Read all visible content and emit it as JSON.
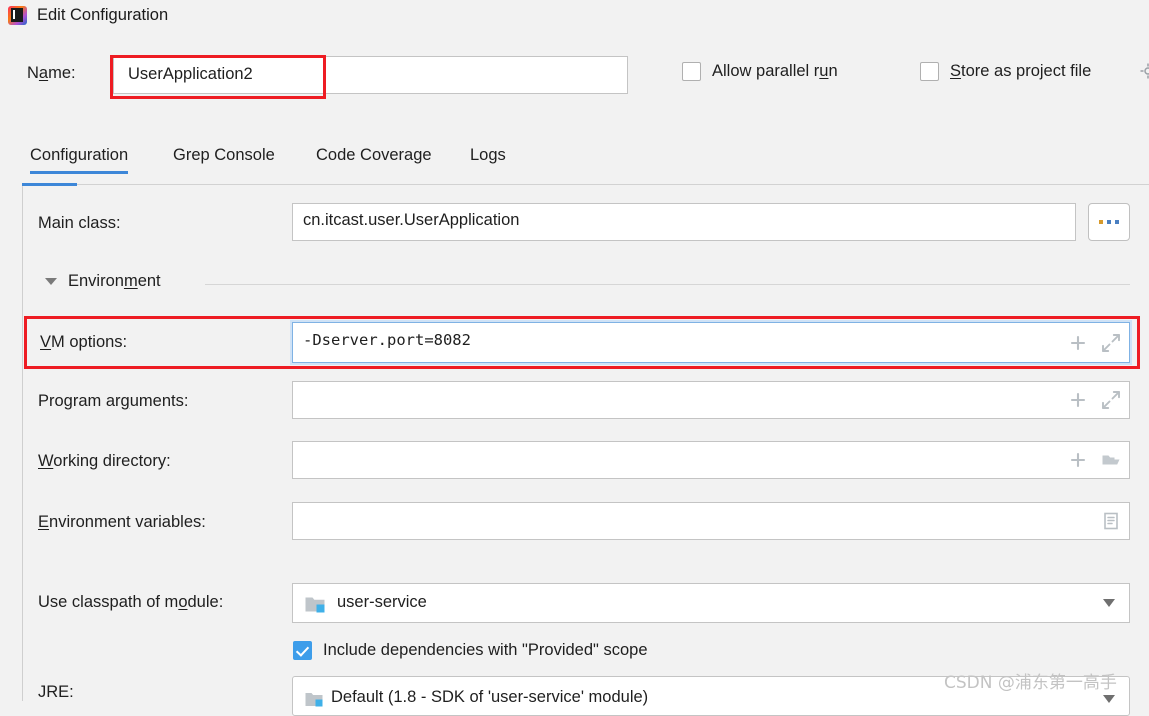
{
  "window": {
    "title": "Edit Configuration",
    "logo_icon": "intellij-idea-logo"
  },
  "name_row": {
    "label_pre": "N",
    "label_mnemonic": "a",
    "label_post": "me:",
    "label_full": "Name:",
    "value": "UserApplication2",
    "highlighted": true,
    "highlight_color": "#ee1c23"
  },
  "checkboxes_top": [
    {
      "name": "allow-parallel-run",
      "label_pre": "Allow parallel r",
      "label_mnemonic": "u",
      "label_post": "n",
      "label_full": "Allow parallel run",
      "checked": false
    },
    {
      "name": "store-as-project-file",
      "label_pre": "",
      "label_mnemonic": "S",
      "label_post": "tore as project file",
      "label_full": "Store as project file",
      "checked": false,
      "trailing_icon": "gear-icon"
    }
  ],
  "tabs": {
    "active_index": 0,
    "accent_color": "#3d87d8",
    "items": [
      {
        "label": "Configuration"
      },
      {
        "label": "Grep Console"
      },
      {
        "label": "Code Coverage"
      },
      {
        "label": "Logs"
      }
    ]
  },
  "form": {
    "main_class": {
      "label": "Main class:",
      "value": "cn.itcast.user.UserApplication",
      "browse_button_label": "...",
      "browse_icon": "ellipsis-icon"
    },
    "environment_section": {
      "label_pre": "Environ",
      "label_mnemonic": "m",
      "label_post": "ent",
      "label_full": "Environment",
      "expanded": true,
      "caret_icon": "chevron-down-icon"
    },
    "vm_options": {
      "label_pre": "",
      "label_mnemonic": "V",
      "label_post": "M options:",
      "label_full": "VM options:",
      "value": "-Dserver.port=8082",
      "focused": true,
      "highlighted": true,
      "highlight_color": "#ee1c23",
      "icons": [
        "plus-icon",
        "expand-icon"
      ]
    },
    "program_arguments": {
      "label_pre": "Program ar",
      "label_mnemonic": "g",
      "label_post": "uments:",
      "label_full": "Program arguments:",
      "value": "",
      "icons": [
        "plus-icon",
        "expand-icon"
      ]
    },
    "working_directory": {
      "label_pre": "",
      "label_mnemonic": "W",
      "label_post": "orking directory:",
      "label_full": "Working directory:",
      "value": "",
      "icons": [
        "plus-icon",
        "folder-icon"
      ]
    },
    "environment_variables": {
      "label_pre": "",
      "label_mnemonic": "E",
      "label_post": "nvironment variables:",
      "label_full": "Environment variables:",
      "value": "",
      "icons": [
        "list-document-icon"
      ]
    },
    "use_classpath_of_module": {
      "label_pre": "Use classpath of m",
      "label_mnemonic": "o",
      "label_post": "dule:",
      "label_full": "Use classpath of module:",
      "value": "user-service",
      "value_icon": "module-folder-icon",
      "dropdown_icon": "chevron-down-icon"
    },
    "include_provided_scope": {
      "label": "Include dependencies with \"Provided\" scope",
      "checked": true,
      "accent_color": "#3d9dea"
    },
    "jre": {
      "label": "JRE:",
      "value": "Default (1.8 - SDK of 'user-service' module)",
      "value_icon": "module-folder-icon",
      "dropdown_icon": "chevron-down-icon"
    }
  },
  "watermark": {
    "text": "CSDN @浦东第一高手"
  }
}
